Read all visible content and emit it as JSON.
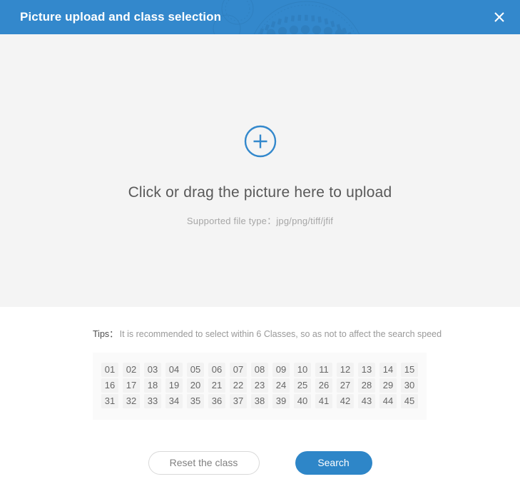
{
  "window": {
    "title": "Picture upload and class selection",
    "close_label": "×",
    "header_color": "#3388cc"
  },
  "upload": {
    "icon": "plus-circle-icon",
    "main_text": "Click or drag the picture here to upload",
    "sub_text": "Supported file type：jpg/png/tiff/jfif",
    "background_color": "#f4f4f4",
    "accent_color": "#3388cc"
  },
  "tips": {
    "label": "Tips：",
    "text": "It is recommended to select within 6 Classes, so as not to affect the search speed"
  },
  "classes": {
    "rows": [
      [
        "01",
        "02",
        "03",
        "04",
        "05",
        "06",
        "07",
        "08",
        "09",
        "10",
        "11",
        "12",
        "13",
        "14",
        "15"
      ],
      [
        "16",
        "17",
        "18",
        "19",
        "20",
        "21",
        "22",
        "23",
        "24",
        "25",
        "26",
        "27",
        "28",
        "29",
        "30"
      ],
      [
        "31",
        "32",
        "33",
        "34",
        "35",
        "36",
        "37",
        "38",
        "39",
        "40",
        "41",
        "42",
        "43",
        "44",
        "45"
      ]
    ]
  },
  "footer": {
    "reset_label": "Reset the class",
    "search_label": "Search",
    "search_color": "#2e86c8"
  }
}
